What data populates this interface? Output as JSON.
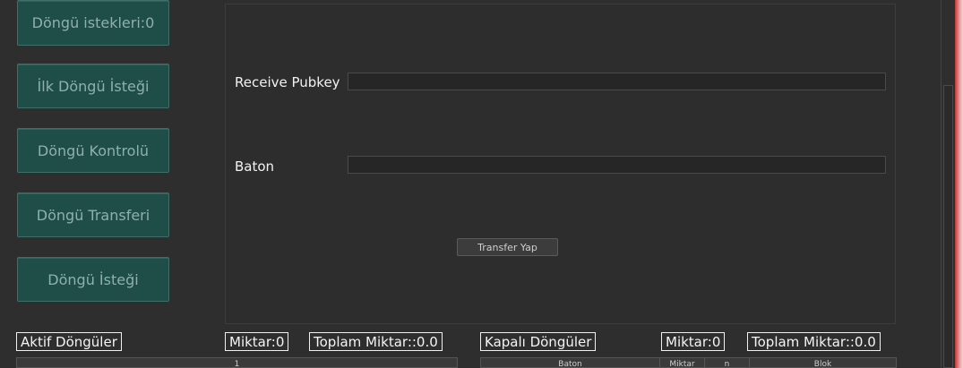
{
  "sidebar": {
    "buttons": [
      "Döngü istekleri:0",
      "İlk Döngü İsteği",
      "Döngü Kontrolü",
      "Döngü Transferi",
      "Döngü İsteği"
    ]
  },
  "form": {
    "receive_pubkey_label": "Receive Pubkey",
    "receive_pubkey_value": "",
    "baton_label": "Baton",
    "baton_value": "",
    "transfer_button": "Transfer Yap"
  },
  "active_loops": {
    "title": "Aktif Döngüler",
    "amount": "Miktar:0",
    "total_amount": "Toplam Miktar::0.0",
    "columns": [
      "1"
    ]
  },
  "closed_loops": {
    "title": "Kapalı Döngüler",
    "amount": "Miktar:0",
    "total_amount": "Toplam Miktar::0.0",
    "columns": [
      "Baton",
      "Miktar",
      "n",
      "Blok"
    ]
  }
}
